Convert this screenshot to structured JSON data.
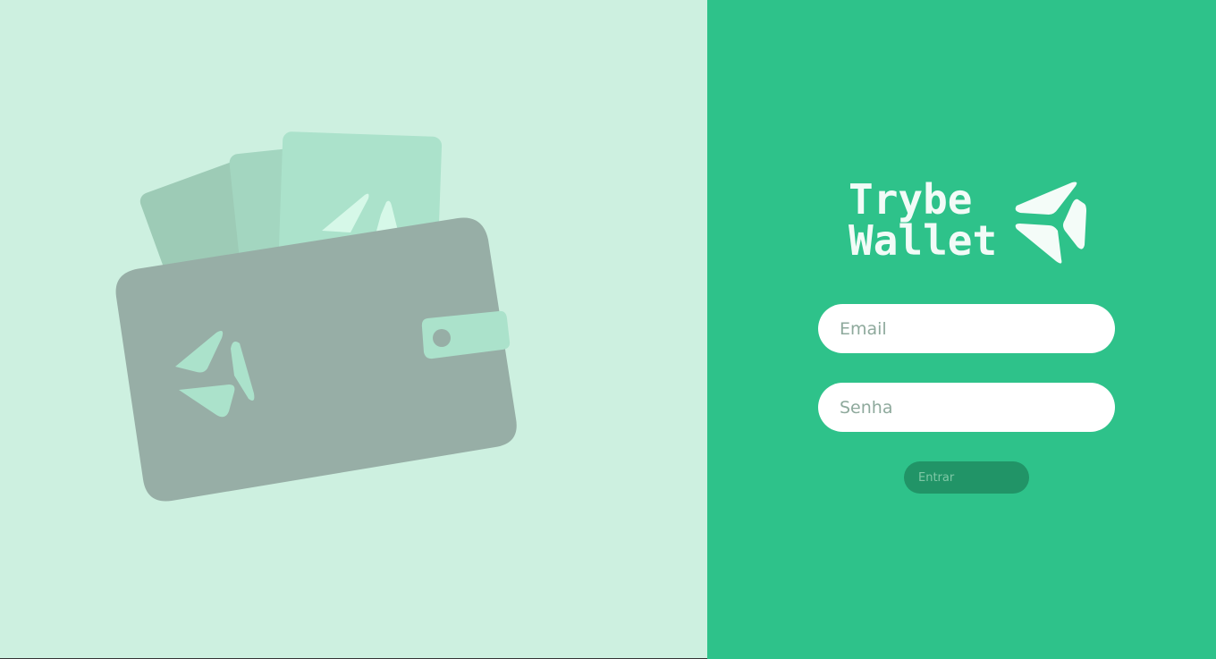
{
  "brand": {
    "line1": "Trybe",
    "line2": "Wallet",
    "logo_icon": "trybe-arrow-icon"
  },
  "login_form": {
    "email_placeholder": "Email",
    "password_placeholder": "Senha",
    "submit_label": "Entrar"
  },
  "illustration": {
    "name": "wallet-illustration"
  },
  "colors": {
    "left_bg": "#cdf0e0",
    "right_bg": "#2ec28a",
    "wallet": "#97aea6",
    "card_light": "#abe2cb",
    "button_bg": "#219467"
  }
}
